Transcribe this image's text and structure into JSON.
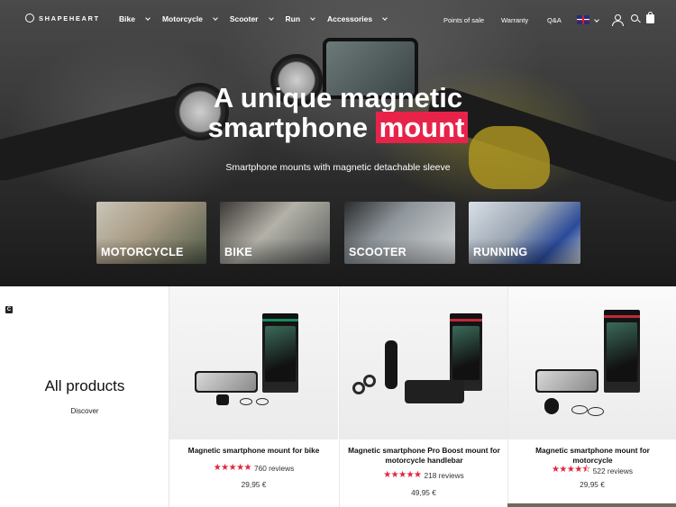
{
  "brand": {
    "logo_text": "SHAPEHEART"
  },
  "nav": {
    "menu": [
      {
        "label": "Bike"
      },
      {
        "label": "Motorcycle"
      },
      {
        "label": "Scooter"
      },
      {
        "label": "Run"
      },
      {
        "label": "Accessories"
      }
    ],
    "links": {
      "points_of_sale": "Points of sale",
      "warranty": "Warranty",
      "qa": "Q&A"
    }
  },
  "hero": {
    "title_line1": "A unique magnetic",
    "title_line2_prefix": "smartphone ",
    "title_highlight": "mount",
    "subtitle": "Smartphone mounts with magnetic detachable sleeve",
    "highlight_color": "#e8234a"
  },
  "categories": [
    {
      "label": "MOTORCYCLE"
    },
    {
      "label": "BIKE"
    },
    {
      "label": "SCOOTER"
    },
    {
      "label": "RUNNING"
    }
  ],
  "all_products": {
    "badge": "C",
    "title": "All products",
    "link": "Discover"
  },
  "products": [
    {
      "name": "Magnetic smartphone mount for bike",
      "stars": "★★★★★",
      "rating": 5,
      "reviews": "760 reviews",
      "price": "29,95 €"
    },
    {
      "name": "Magnetic smartphone Pro Boost mount for motorcycle handlebar",
      "stars": "★★★★★",
      "rating": 5,
      "reviews": "218 reviews",
      "price": "49,95 €"
    },
    {
      "name": "Magnetic smartphone mount for motorcycle",
      "stars": "★★★★⯪",
      "rating": 4.5,
      "reviews": "522 reviews",
      "price": "29,95 €"
    }
  ],
  "colors": {
    "star": "#e0263e",
    "accent": "#e8234a"
  }
}
